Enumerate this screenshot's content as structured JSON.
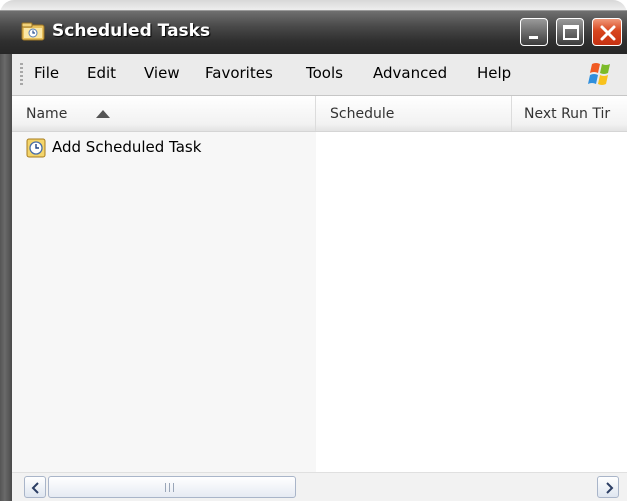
{
  "window": {
    "title": "Scheduled Tasks",
    "icon": "folder-clock-icon",
    "controls": [
      "minimize",
      "maximize",
      "close"
    ]
  },
  "menubar": {
    "items": [
      "File",
      "Edit",
      "View",
      "Favorites",
      "Tools",
      "Advanced",
      "Help"
    ],
    "logo": "windows-flag-icon"
  },
  "list": {
    "columns": [
      {
        "label": "Name",
        "sorted": "ascending"
      },
      {
        "label": "Schedule"
      },
      {
        "label": "Next Run Tir"
      }
    ],
    "items": [
      {
        "label": "Add Scheduled Task",
        "icon": "add-task-icon"
      }
    ]
  },
  "scrollbar": {
    "orientation": "horizontal",
    "left_arrow": "chevron-left-icon",
    "right_arrow": "chevron-right-icon"
  },
  "colors": {
    "titlebar": "#2f2f2f",
    "title_text": "#ffffff",
    "close_button": "#d8461e",
    "menubar": "#ebebeb",
    "name_column_bg": "#f7f7f7"
  }
}
